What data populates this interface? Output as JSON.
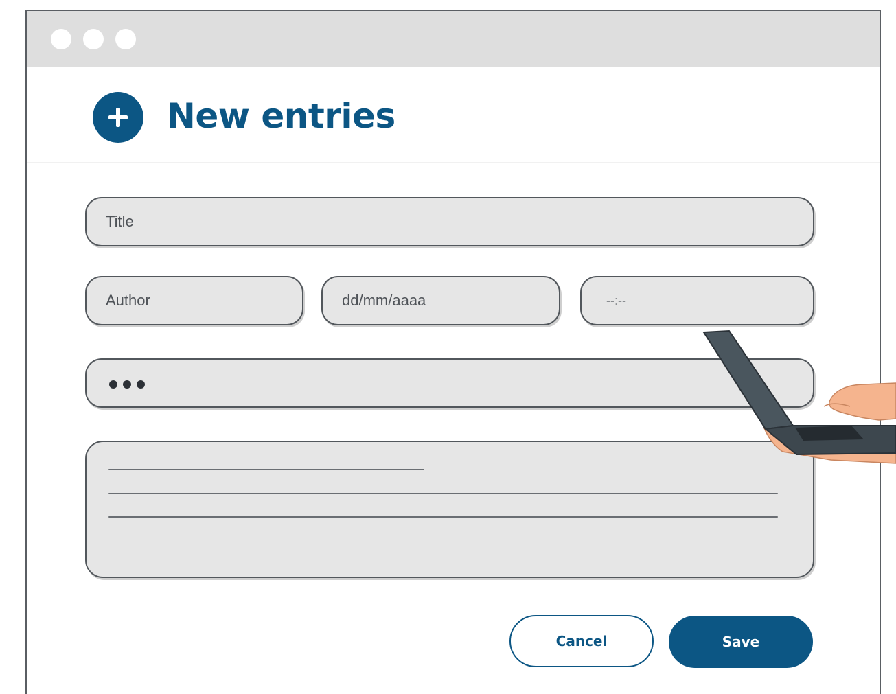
{
  "window": {
    "controls": [
      "window-dot",
      "window-dot",
      "window-dot"
    ]
  },
  "header": {
    "icon": "plus-circle-icon",
    "title": "New entries"
  },
  "form": {
    "title_placeholder": "Title",
    "author_placeholder": "Author",
    "date_placeholder": "dd/mm/aaaa",
    "time_placeholder": "--:--",
    "password_value": "•••",
    "notes_value": ""
  },
  "actions": {
    "cancel_label": "Cancel",
    "save_label": "Save"
  },
  "colors": {
    "accent": "#0c5684",
    "field_background": "#e6e6e6",
    "titlebar": "#dedede"
  }
}
